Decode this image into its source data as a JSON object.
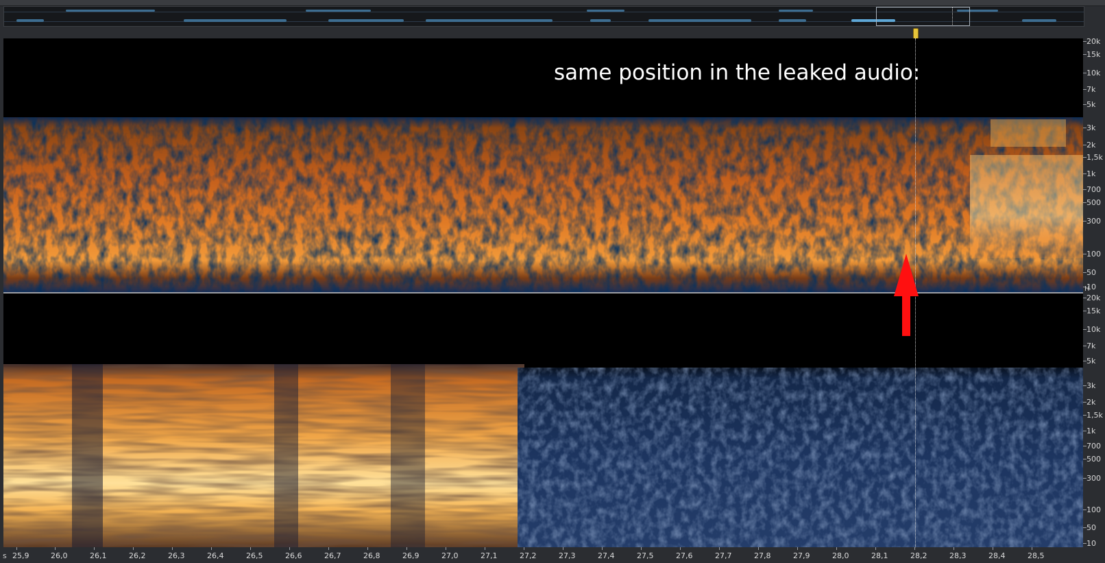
{
  "annotation": {
    "text": "same position in the leaked audio:"
  },
  "frequency_axis": {
    "labels": [
      "20k",
      "15k",
      "10k",
      "7k",
      "5k",
      "3k",
      "2k",
      "1,5k",
      "1k",
      "700",
      "500",
      "300",
      "100",
      "50",
      "10"
    ],
    "unit": "H"
  },
  "time_axis": {
    "unit": "s",
    "labels": [
      "25,9",
      "26,0",
      "26,1",
      "26,2",
      "26,3",
      "26,4",
      "26,5",
      "26,6",
      "26,7",
      "26,8",
      "26,9",
      "27,0",
      "27,1",
      "27,2",
      "27,3",
      "27,4",
      "27,5",
      "27,6",
      "27,7",
      "27,8",
      "27,9",
      "28,0",
      "28,1",
      "28,2",
      "28,3",
      "28,4",
      "28,5"
    ]
  },
  "icons": {
    "arrow": "red-up-arrow-icon",
    "marker": "playhead-marker-icon"
  },
  "colors": {
    "spectrum_hot": "#ffe28a",
    "spectrum_warm": "#d46a1e",
    "spectrum_cool": "#1f3a6b",
    "arrow": "#ff1010",
    "marker": "#e6c53a"
  }
}
